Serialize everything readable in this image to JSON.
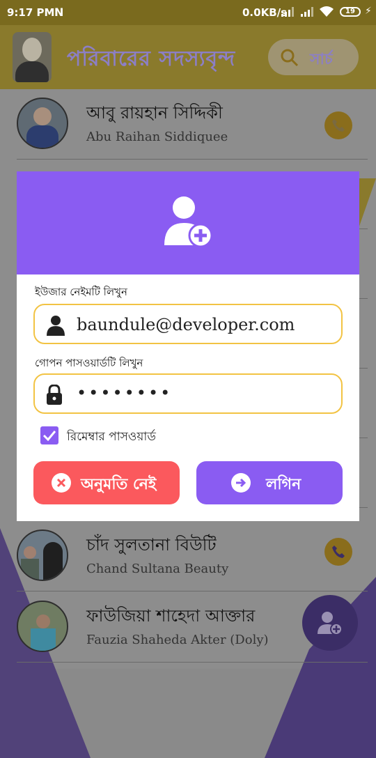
{
  "status_bar": {
    "time": "9:17 PM",
    "notification_icon": "N",
    "network_speed": "0.0KB/s",
    "battery_level": "19"
  },
  "app_bar": {
    "title": "পরিবারের সদস্যবৃন্দ",
    "search_label": "সার্চ"
  },
  "members": [
    {
      "name_bn": "আবু রায়হান সিদ্দিকী",
      "name_en": "Abu Raihan Siddiquee"
    },
    {
      "name_bn": "চাঁদ সুলতানা বিউটি",
      "name_en": "Chand Sultana Beauty"
    },
    {
      "name_bn": "ফাউজিয়া শাহেদা আক্তার",
      "name_en": "Fauzia Shaheda Akter (Doly)"
    }
  ],
  "login_dialog": {
    "username_label": "ইউজার নেইমটি লিখুন",
    "username_value": "baundule@developer.com",
    "password_label": "গোপন পাসওয়ার্ডটি লিখুন",
    "password_value": "••••••••",
    "remember_label": "রিমেম্বার পাসওয়ার্ড",
    "remember_checked": true,
    "deny_button": "অনুমতি নেই",
    "login_button": "লগিন"
  },
  "colors": {
    "accent_purple": "#8a5cf2",
    "deny_red": "#fb595d",
    "field_border_yellow": "#f2c343"
  }
}
